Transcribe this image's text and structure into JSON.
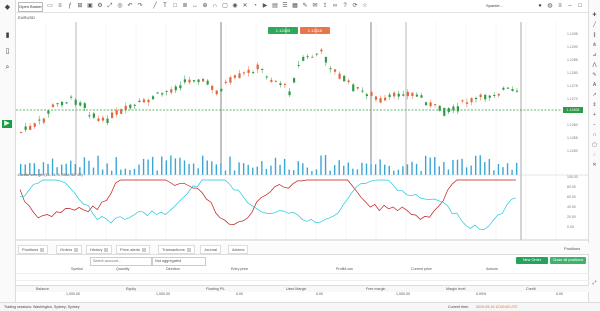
{
  "toolbar": {
    "symbol_label": "EURUSD",
    "app_logo": "Open Broker"
  },
  "header": {
    "account_label": "Sparkie..."
  },
  "chart": {
    "sell_price": "1.12405",
    "buy_price": "1.12416",
    "current_price": "1.12408",
    "yaxis_ticks": [
      "1.1295",
      "1.1290",
      "1.1285",
      "1.1280",
      "1.1275",
      "1.1270",
      "1.1265",
      "1.1260",
      "1.1255",
      "1.1250"
    ],
    "osc_ticks": [
      "100.00",
      "80.00",
      "60.00",
      "40.00",
      "20.00",
      "0.00"
    ],
    "osc_caption": "Candle strength (14, 14, 3, SMA, 80, 20)",
    "colors": {
      "up": "#2e9c45",
      "down": "#e0683a",
      "osc_a": "#c41a1a",
      "osc_b": "#22c7de",
      "volume": "#3aa6d6",
      "hline": "#2e9c45"
    }
  },
  "tabs": [
    {
      "label": "Positions"
    },
    {
      "label": "Orders"
    },
    {
      "label": "History"
    },
    {
      "label": "Price alerts"
    },
    {
      "label": "Transactions"
    },
    {
      "label": "Journal"
    },
    {
      "label": "Alarms"
    }
  ],
  "tab_right": "Positions",
  "filters": {
    "account_placeholder": "Select account...",
    "group_label": "Not aggregated",
    "new_order_label": "New Order",
    "close_all_label": "Close all positions"
  },
  "columns": [
    "Symbol",
    "Quantity",
    "Direction",
    "Entry price",
    "Profit/Loss",
    "Current price",
    "Actions"
  ],
  "summary_headers": [
    "Balance",
    "Equity",
    "Floating P/L",
    "Used Margin",
    "Free margin",
    "Margin level",
    "Credit"
  ],
  "summary_values": [
    "1,000.00",
    "1,000.00",
    "0.00",
    "0.00",
    "1,000.00",
    "0.00%",
    "0.00"
  ],
  "status": {
    "left": "Trading sessions: Washington, Sydney, Sydney",
    "right_label": "Current time:",
    "right_value": "2019-09-19 12:00:00 UTC"
  }
}
